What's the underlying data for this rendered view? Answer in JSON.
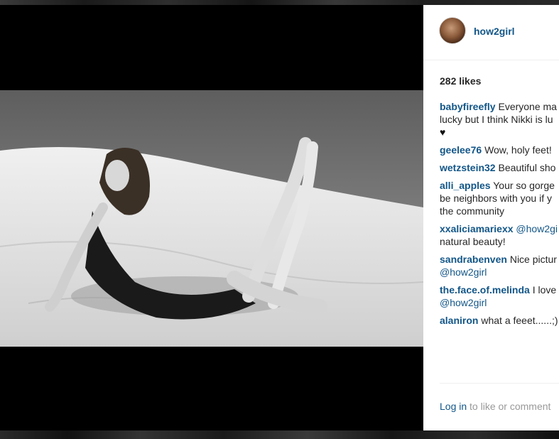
{
  "post": {
    "author": {
      "username": "how2girl"
    },
    "likes_text": "282 likes",
    "comments": [
      {
        "user": "babyfireefly",
        "lines": [
          "Everyone ma",
          "lucky but I think Nikki is lu",
          "♥"
        ]
      },
      {
        "user": "geelee76",
        "lines": [
          "Wow, holy feet!"
        ]
      },
      {
        "user": "wetzstein32",
        "lines": [
          "Beautiful sho"
        ]
      },
      {
        "user": "alli_apples",
        "lines": [
          "Your so gorge",
          "be neighbors with you if y",
          "the community"
        ]
      },
      {
        "user": "xxaliciamariexx",
        "mention": "@how2gi",
        "lines": [
          "natural beauty!"
        ]
      },
      {
        "user": "sandrabenven",
        "lines": [
          "Nice pictur"
        ],
        "mention_line": "@how2girl"
      },
      {
        "user": "the.face.of.melinda",
        "lines": [
          "I love"
        ],
        "mention_line": "@how2girl"
      },
      {
        "user": "alaniron",
        "lines": [
          "what a feeet......;)"
        ]
      }
    ],
    "login": {
      "link": "Log in",
      "rest": " to like or comment"
    }
  },
  "colors": {
    "link": "#125688",
    "text": "#262626",
    "muted": "#999999"
  }
}
